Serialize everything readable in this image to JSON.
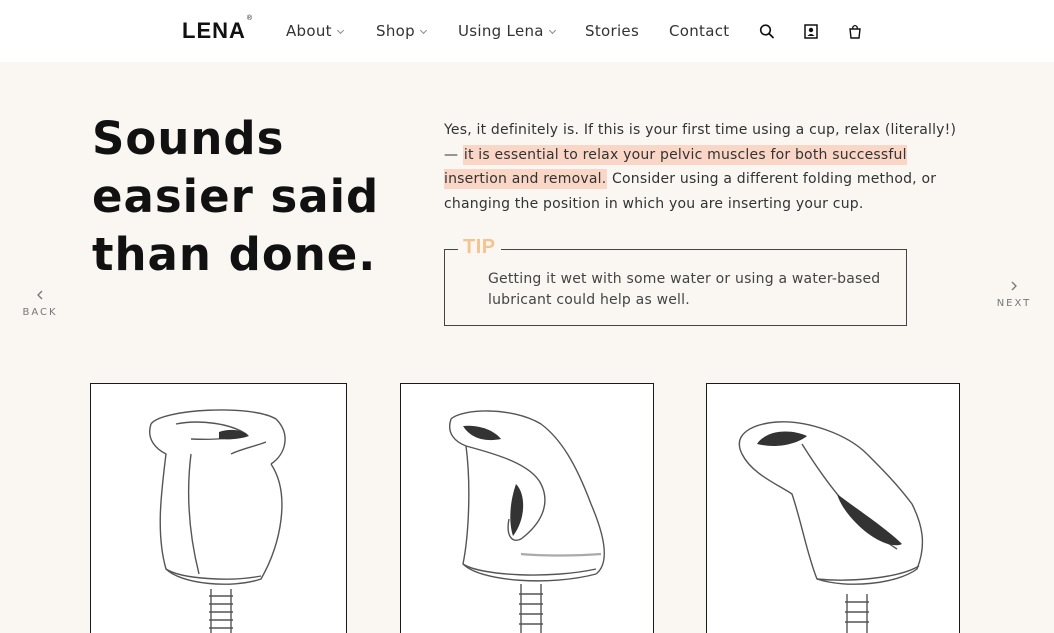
{
  "brand": {
    "logo_text": "LENA",
    "registered_mark": "®"
  },
  "nav": {
    "items": [
      {
        "label": "About",
        "has_dropdown": true
      },
      {
        "label": "Shop",
        "has_dropdown": true
      },
      {
        "label": "Using Lena",
        "has_dropdown": true
      },
      {
        "label": "Stories",
        "has_dropdown": false
      },
      {
        "label": "Contact",
        "has_dropdown": false
      }
    ],
    "icons": [
      "search-icon",
      "account-icon",
      "cart-icon"
    ]
  },
  "content": {
    "headline": "Sounds\neasier said\nthan done.",
    "body_intro": "Yes, it definitely is. If this is your first time using a cup, relax (literally!) — ",
    "body_highlight": "it is essential to relax your pelvic muscles for both successful insertion and removal.",
    "body_outro": " Consider using a different folding method, or changing the position in which you are inserting your cup.",
    "tip_label": "TIP",
    "tip_text": "Getting it wet with some water or using a water-based lubricant could help as well."
  },
  "pager": {
    "back_label": "BACK",
    "next_label": "NEXT"
  },
  "cards": [
    {
      "icon": "cup-fold-illustration-1"
    },
    {
      "icon": "cup-fold-illustration-2"
    },
    {
      "icon": "cup-fold-illustration-3"
    }
  ],
  "colors": {
    "background": "#faf7f3",
    "header": "#ffffff",
    "highlight": "#fad6c6",
    "tip_accent": "#f6c38f",
    "text": "#222222"
  }
}
